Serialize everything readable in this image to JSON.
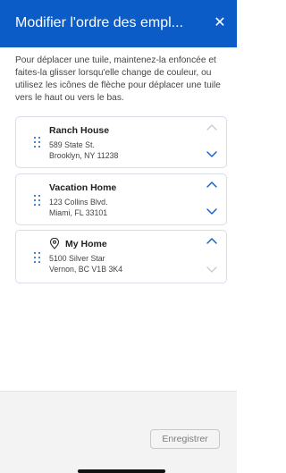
{
  "header": {
    "title": "Modifier l'ordre des empl...",
    "close_symbol": "✕",
    "color": "#0b5cc7"
  },
  "instructions": "Pour déplacer une tuile, maintenez-la enfoncée et faites-la glisser lorsqu'elle change de couleur, ou utilisez les icônes de flèche pour déplacer une tuile vers le haut ou vers le bas.",
  "tiles": [
    {
      "name": "Ranch House",
      "address_line1": "589 State St.",
      "address_line2": "Brooklyn, NY 11238",
      "up_enabled": false,
      "down_enabled": true
    },
    {
      "name": "Vacation Home",
      "address_line1": "123 Collins Blvd.",
      "address_line2": "Miami, FL 33101",
      "up_enabled": true,
      "down_enabled": true
    },
    {
      "name": "My Home",
      "icon": "location-pin-icon",
      "address_line1": "5100 Silver Star",
      "address_line2": "Vernon, BC V1B 3K4",
      "up_enabled": true,
      "down_enabled": false
    }
  ],
  "footer": {
    "save_label": "Enregistrer"
  },
  "colors": {
    "accent": "#0b5cc7",
    "disabled_arrow": "#c8ccd2",
    "border": "#d8dde6"
  }
}
